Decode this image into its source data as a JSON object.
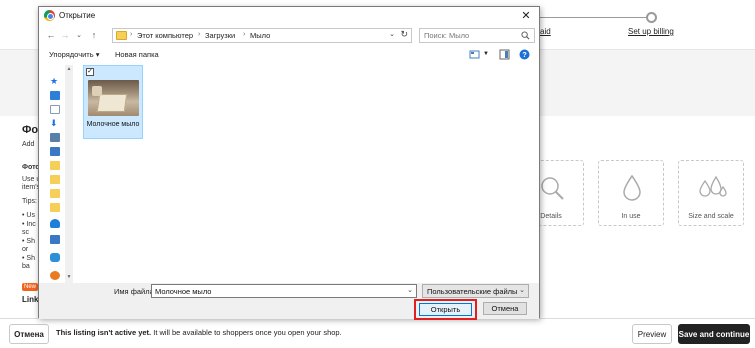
{
  "page": {
    "steps": [
      {
        "label": "aid"
      },
      {
        "label": "Set up billing"
      }
    ],
    "section_title": "Фот",
    "section_lines": [
      "Add",
      "Фото",
      "Use u",
      "item's",
      "Tips:",
      "• Us",
      "• Inc",
      "  sc",
      "• Sh",
      "  or",
      "• Sh",
      "  ba"
    ],
    "new_badge": "New",
    "link_text": "Link p",
    "tiles": [
      {
        "label": "Details",
        "icon": "magnifier-icon"
      },
      {
        "label": "In use",
        "icon": "drop-hand-icon"
      },
      {
        "label": "Size and scale",
        "icon": "drops-icon"
      }
    ],
    "bottom_bar": {
      "cancel_label": "Отмена",
      "note_bold": "This listing isn't active yet.",
      "note_rest": " It will be available to shoppers once you open your shop.",
      "preview_label": "Preview",
      "save_label": "Save and continue"
    }
  },
  "dialog": {
    "title": "Открытие",
    "breadcrumbs": [
      "Этот компьютер",
      "Загрузки",
      "Мыло"
    ],
    "search_placeholder": "Поиск: Мыло",
    "toolbar": {
      "organize_label": "Упорядочить ▾",
      "new_folder_label": "Новая папка"
    },
    "files": [
      {
        "name": "Молочное мыло",
        "selected": true
      }
    ],
    "filename_label": "Имя файла:",
    "filename_value": "Молочное мыло",
    "filter_value": "Пользовательские файлы",
    "open_label": "Открыть",
    "cancel_label": "Отмена"
  },
  "colors": {
    "highlight": "#e02020",
    "selection": "#cce8ff",
    "primary_dark": "#222222",
    "badge": "#f1641e"
  }
}
